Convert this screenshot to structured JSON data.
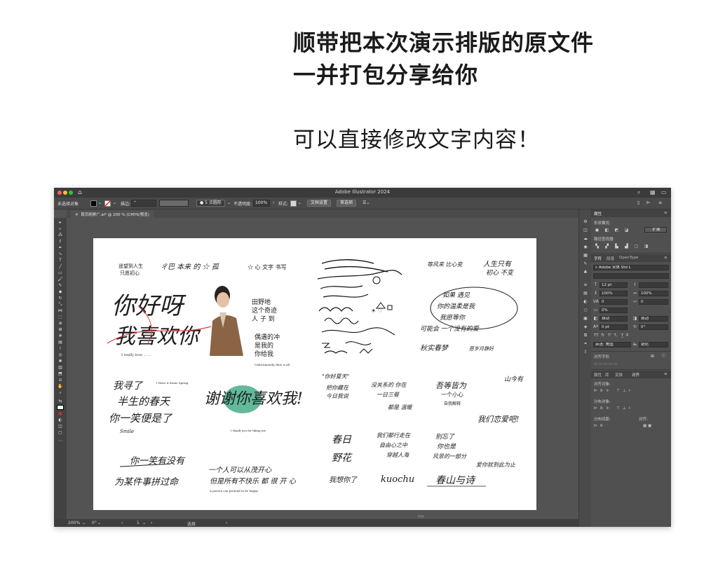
{
  "promo": {
    "line1": "顺带把本次演示排版的原文件",
    "line2": "一并打包分享给你",
    "line3": "可以直接修改文字内容！"
  },
  "app": {
    "title": "Adobe Illustrator 2024",
    "control_bar": {
      "selection": "未选择对象",
      "stroke_label": "描边:",
      "brush_label": "5 点圆形",
      "opacity_label": "不透明度:",
      "opacity_value": "100%",
      "style_label": "样式:",
      "doc_setup_button": "文档设置",
      "preferences_button": "首选项"
    },
    "doc_tab": "首页刷屏广.ai* @ 200 % (CMYK/预览)",
    "status_bar": {
      "zoom": "200%",
      "rotation": "0°",
      "artboard": "1",
      "tool": "选择"
    },
    "properties": {
      "tab_properties": "属性",
      "shape_mode_label": "形状模式:",
      "expand_button": "扩展",
      "pathfinder_label": "路径查找器:",
      "char_tab": "字符",
      "para_tab": "段落",
      "opentype_tab": "OpenType",
      "font_name": "Adobe 宋体 Std L",
      "font_size": "12 pt",
      "leading": "",
      "scale_v": "100%",
      "scale_h": "100%",
      "tracking": "0",
      "kerning": "0",
      "baseline_pct": "0%",
      "auto_1": "自动",
      "auto_2": "自动",
      "shift": "0 pt",
      "rotate": "0°",
      "language": "英语: 美国",
      "aa": "锐化",
      "align_tab_label": "对齐字形",
      "ap_tab_1": "属性",
      "ap_tab_2": "库",
      "ap_tab_3": "变换",
      "ap_tab_4": "对齐",
      "align_objects": "对齐对象:",
      "distribute_objects": "分布对象:",
      "distribute_spacing": "分布间距:",
      "align_to": "对齐:"
    }
  },
  "artboard_text": {
    "main_phrase_1": "你好呀",
    "main_phrase_2": "我喜欢你",
    "phrase_a": "我寻了半生的春天",
    "phrase_a2": "你一笑便是了",
    "phrase_a3": "Smile",
    "phrase_b": "谢谢你喜欢我!",
    "phrase_c": "你一笑有没有",
    "phrase_c2": "为某件事拼过命",
    "phrase_d": "一个人可以从茂开心",
    "phrase_e": "春日野花",
    "phrase_f": "kuochu",
    "phrase_g": "春山与诗",
    "phrase_h": "我们恋爱吧!",
    "phrase_i": "爱你就到此为止",
    "phrase_j": "山今有"
  }
}
